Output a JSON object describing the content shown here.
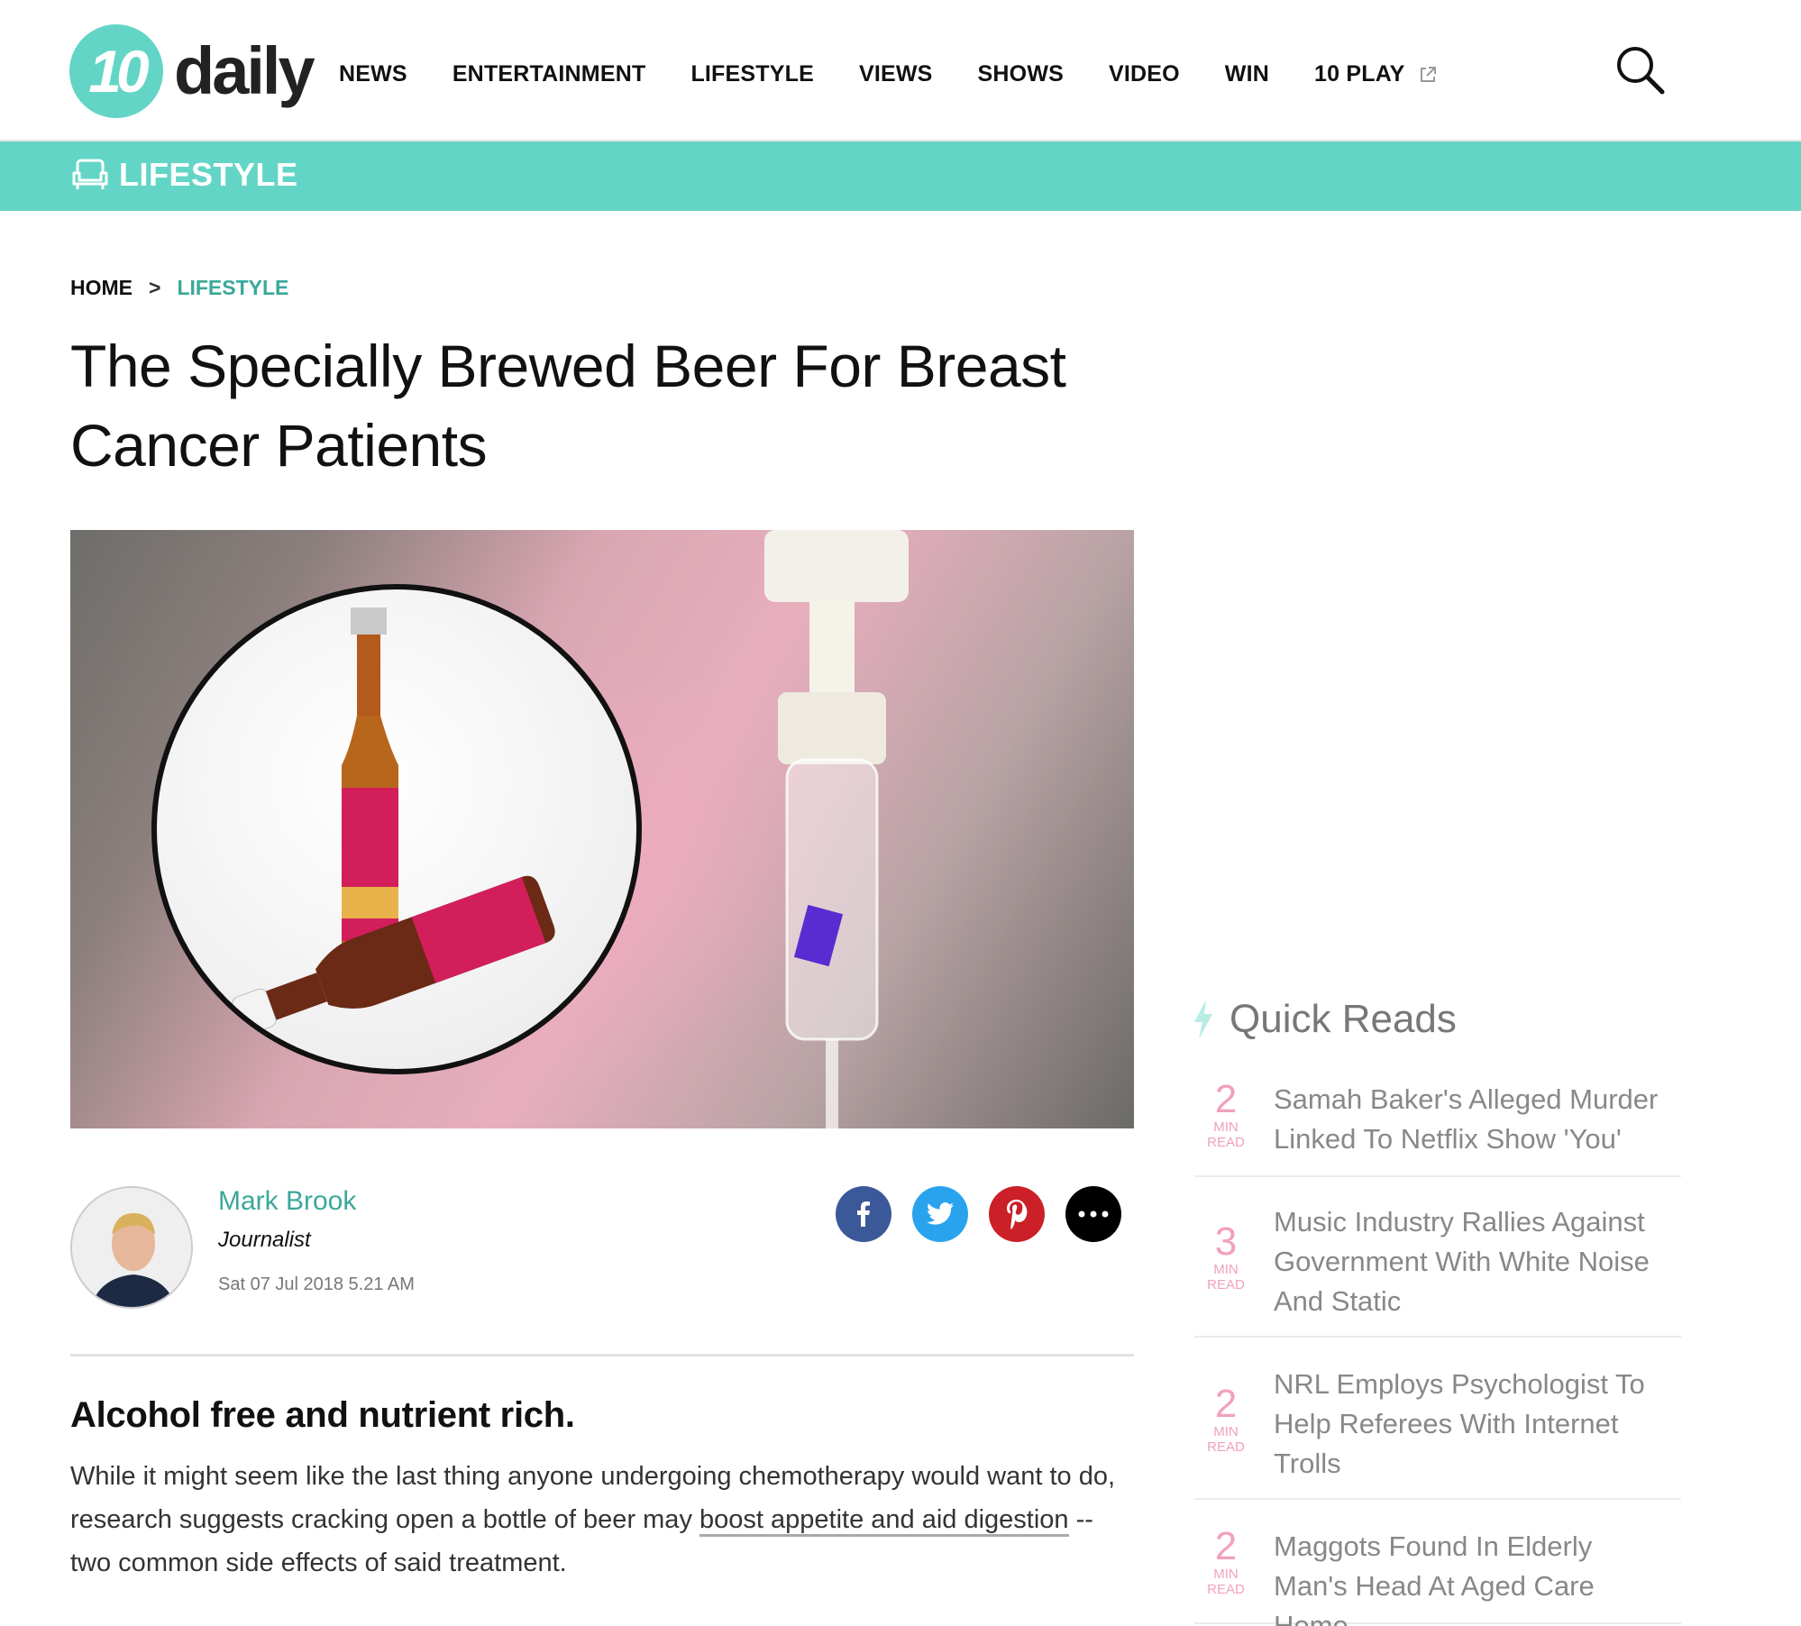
{
  "header": {
    "logo_number": "10",
    "logo_word": "daily",
    "nav": [
      {
        "label": "NEWS"
      },
      {
        "label": "ENTERTAINMENT"
      },
      {
        "label": "LIFESTYLE"
      },
      {
        "label": "VIEWS"
      },
      {
        "label": "SHOWS"
      },
      {
        "label": "VIDEO"
      },
      {
        "label": "WIN"
      },
      {
        "label": "10 PLAY",
        "icon": "external-link-icon"
      }
    ],
    "search_icon": "search-icon"
  },
  "section_band": {
    "icon": "armchair-icon",
    "label": "LIFESTYLE",
    "color": "#63d5c6"
  },
  "breadcrumb": {
    "home": "HOME",
    "separator": ">",
    "current": "LIFESTYLE"
  },
  "article": {
    "title": "The Specially Brewed Beer For Breast Cancer Patients",
    "author": {
      "name": "Mark Brook",
      "role": "Journalist",
      "date": "Sat 07 Jul 2018 5.21 AM"
    },
    "share": [
      {
        "icon": "facebook-icon",
        "color": "#3b5998"
      },
      {
        "icon": "twitter-icon",
        "color": "#2aa3ef"
      },
      {
        "icon": "pinterest-icon",
        "color": "#cb2027"
      },
      {
        "icon": "more-icon",
        "color": "#000000"
      }
    ],
    "standfirst": "Alcohol free and nutrient rich.",
    "body": {
      "before_link": "While it might seem like the last thing anyone undergoing chemotherapy would want to do, research suggests cracking open a bottle of beer may ",
      "link": "boost appetite and aid digestion",
      "after_link": " -- two common side effects of said treatment."
    }
  },
  "quick_reads": {
    "title": "Quick Reads",
    "icon": "lightning-icon",
    "min_label": "MIN",
    "read_label": "READ",
    "items": [
      {
        "minutes": "2",
        "title": "Samah Baker's Alleged Murder Linked To Netflix Show 'You'"
      },
      {
        "minutes": "3",
        "title": "Music Industry Rallies Against Government With White Noise And Static"
      },
      {
        "minutes": "2",
        "title": "NRL Employs Psychologist To Help Referees With Internet Trolls"
      },
      {
        "minutes": "2",
        "title": "Maggots Found In Elderly Man's Head At Aged Care Home"
      }
    ]
  },
  "colors": {
    "accent": "#63d5c6",
    "accent_text": "#3aa89a",
    "quick_read_number": "#f2a0bd"
  }
}
